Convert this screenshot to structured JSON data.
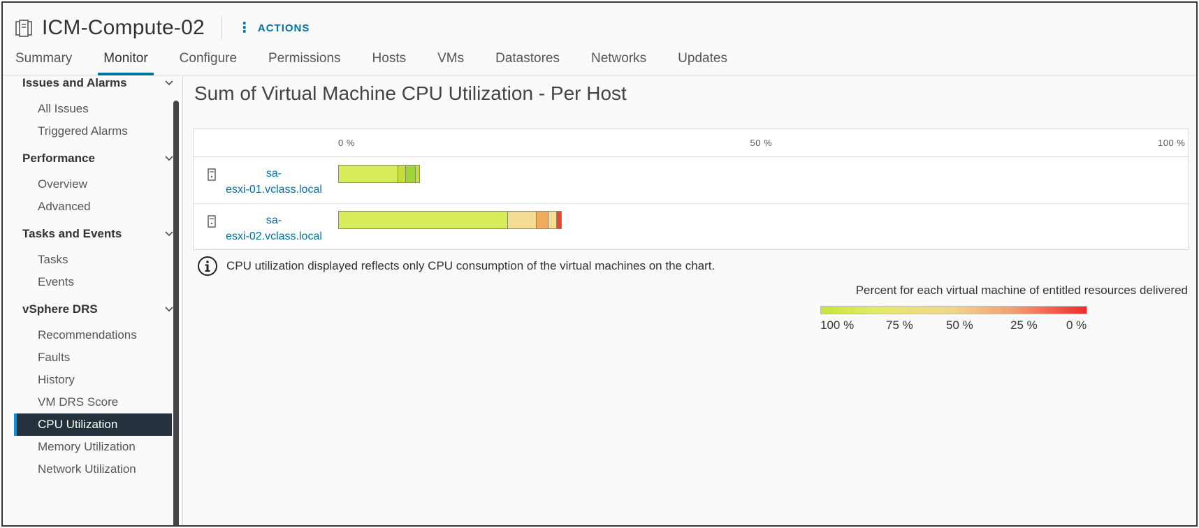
{
  "header": {
    "title": "ICM-Compute-02",
    "actions_label": "ACTIONS"
  },
  "tabs": [
    {
      "label": "Summary"
    },
    {
      "label": "Monitor",
      "active": true
    },
    {
      "label": "Configure"
    },
    {
      "label": "Permissions"
    },
    {
      "label": "Hosts"
    },
    {
      "label": "VMs"
    },
    {
      "label": "Datastores"
    },
    {
      "label": "Networks"
    },
    {
      "label": "Updates"
    }
  ],
  "sidebar": {
    "groups": [
      {
        "label": "Issues and Alarms",
        "items": [
          "All Issues",
          "Triggered Alarms"
        ]
      },
      {
        "label": "Performance",
        "items": [
          "Overview",
          "Advanced"
        ]
      },
      {
        "label": "Tasks and Events",
        "items": [
          "Tasks",
          "Events"
        ]
      },
      {
        "label": "vSphere DRS",
        "items": [
          "Recommendations",
          "Faults",
          "History",
          "VM DRS Score",
          "CPU Utilization",
          "Memory Utilization",
          "Network Utilization"
        ]
      }
    ],
    "selected": "CPU Utilization"
  },
  "main": {
    "title": "Sum of Virtual Machine CPU Utilization - Per Host",
    "info_text": "CPU utilization displayed reflects only CPU consumption of the virtual machines on the chart.",
    "legend_title": "Percent for each virtual machine of entitled resources delivered",
    "legend_ticks": [
      "100 %",
      "75 %",
      "50 %",
      "25 %",
      "0 %"
    ],
    "legend_colors": [
      "#c8e43c",
      "#f2d78a",
      "#ee2b2b"
    ]
  },
  "chart_data": {
    "type": "bar",
    "orientation": "horizontal",
    "stacked": true,
    "xlim": [
      0,
      100
    ],
    "x_ticks": [
      "0 %",
      "50 %",
      "100 %"
    ],
    "categories": [
      "sa-esxi-01.vclass.local",
      "sa-esxi-02.vclass.local"
    ],
    "host_labels": [
      [
        "sa-",
        "esxi-01.vclass.local"
      ],
      [
        "sa-",
        "esxi-02.vclass.local"
      ]
    ],
    "rows": [
      {
        "host": "sa-esxi-01.vclass.local",
        "segments": [
          {
            "value": 7.0,
            "color": "#d9ec5c"
          },
          {
            "value": 0.9,
            "color": "#c4df3a"
          },
          {
            "value": 1.2,
            "color": "#9fd63a"
          },
          {
            "value": 0.4,
            "color": "#c4df3a"
          }
        ]
      },
      {
        "host": "sa-esxi-02.vclass.local",
        "segments": [
          {
            "value": 20.0,
            "color": "#d9ec5c"
          },
          {
            "value": 3.4,
            "color": "#f5dc93"
          },
          {
            "value": 1.4,
            "color": "#f2ab5a"
          },
          {
            "value": 1.0,
            "color": "#f5dc93"
          },
          {
            "value": 0.5,
            "color": "#e8472b"
          }
        ]
      }
    ]
  }
}
